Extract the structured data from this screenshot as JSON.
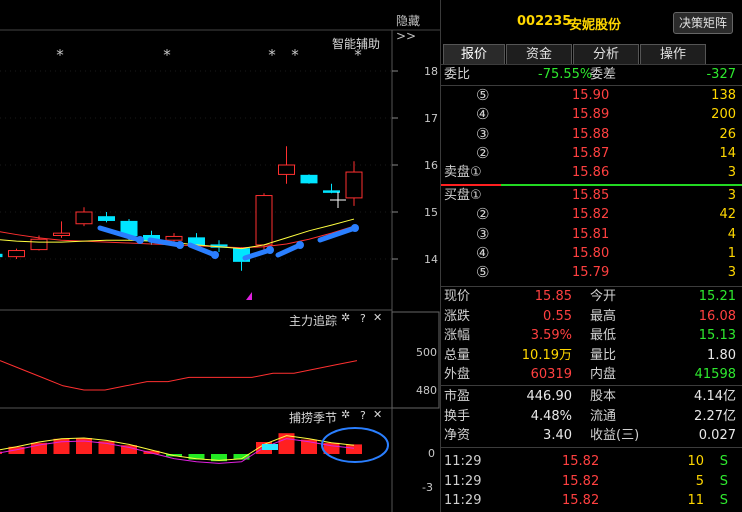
{
  "top_bar": {
    "hide_label": "隐藏>>",
    "smart_aid_label": "智能辅助"
  },
  "header": {
    "code": "002235",
    "name": "安妮股份",
    "decision_button": "决策矩阵"
  },
  "tabs": [
    "报价",
    "资金",
    "分析",
    "操作"
  ],
  "weibi": {
    "label": "委比",
    "ratio": "-75.55%",
    "diff_label": "委差",
    "diff": "-327"
  },
  "sell_levels": [
    {
      "label": "⑤",
      "price": "15.90",
      "volume": "138"
    },
    {
      "label": "④",
      "price": "15.89",
      "volume": "200"
    },
    {
      "label": "③",
      "price": "15.88",
      "volume": "26"
    },
    {
      "label": "②",
      "price": "15.87",
      "volume": "14"
    },
    {
      "label": "卖盘①",
      "price": "15.86",
      "volume": "3"
    }
  ],
  "buy_levels": [
    {
      "label": "买盘①",
      "price": "15.85",
      "volume": "3"
    },
    {
      "label": "②",
      "price": "15.82",
      "volume": "42"
    },
    {
      "label": "③",
      "price": "15.81",
      "volume": "4"
    },
    {
      "label": "④",
      "price": "15.80",
      "volume": "1"
    },
    {
      "label": "⑤",
      "price": "15.79",
      "volume": "3"
    }
  ],
  "stats": [
    {
      "l1": "现价",
      "v1": "15.85",
      "l2": "今开",
      "v2": "15.21"
    },
    {
      "l1": "涨跌",
      "v1": "0.55",
      "l2": "最高",
      "v2": "16.08"
    },
    {
      "l1": "涨幅",
      "v1": "3.59%",
      "l2": "最低",
      "v2": "15.13"
    },
    {
      "l1": "总量",
      "v1": "10.19万",
      "l2": "量比",
      "v2": "1.80"
    },
    {
      "l1": "外盘",
      "v1": "60319",
      "l2": "内盘",
      "v2": "41598"
    }
  ],
  "fundamentals": [
    {
      "l1": "市盈",
      "v1": "446.90",
      "l2": "股本",
      "v2": "4.14亿"
    },
    {
      "l1": "换手",
      "v1": "4.48%",
      "l2": "流通",
      "v2": "2.27亿"
    },
    {
      "l1": "净资",
      "v1": "3.40",
      "l2": "收益(三)",
      "v2": "0.027"
    }
  ],
  "ticks": [
    {
      "time": "11:29",
      "price": "15.82",
      "vol": "10",
      "side": "S"
    },
    {
      "time": "11:29",
      "price": "15.82",
      "vol": "5",
      "side": "S"
    },
    {
      "time": "11:29",
      "price": "15.82",
      "vol": "11",
      "side": "S"
    }
  ],
  "price_axis": [
    "18",
    "17",
    "16",
    "15",
    "14"
  ],
  "panel2": {
    "title": "主力追踪",
    "axis": [
      "500",
      "480"
    ]
  },
  "panel3": {
    "title": "捕捞季节",
    "axis": [
      "0",
      "-3"
    ]
  },
  "colors": {
    "up": "#ff3030",
    "down": "#00e5ff",
    "green": "#22e822",
    "accent": "#2a7fff"
  },
  "chart_data": [
    {
      "type": "candlestick",
      "title": "",
      "ylim": [
        13.5,
        18.4
      ],
      "y_ticks": [
        18,
        17,
        16,
        15,
        14
      ],
      "candles": [
        {
          "o": 14.1,
          "c": 14.05,
          "h": 14.12,
          "l": 14.0
        },
        {
          "o": 14.05,
          "c": 14.18,
          "h": 14.22,
          "l": 14.0
        },
        {
          "o": 14.2,
          "c": 14.42,
          "h": 14.5,
          "l": 14.18
        },
        {
          "o": 14.5,
          "c": 14.55,
          "h": 14.8,
          "l": 14.45
        },
        {
          "o": 14.75,
          "c": 15.0,
          "h": 15.1,
          "l": 14.7
        },
        {
          "o": 14.9,
          "c": 14.82,
          "h": 15.0,
          "l": 14.78
        },
        {
          "o": 14.8,
          "c": 14.5,
          "h": 14.85,
          "l": 14.4
        },
        {
          "o": 14.5,
          "c": 14.4,
          "h": 14.6,
          "l": 14.3
        },
        {
          "o": 14.4,
          "c": 14.48,
          "h": 14.55,
          "l": 14.35
        },
        {
          "o": 14.45,
          "c": 14.3,
          "h": 14.55,
          "l": 14.2
        },
        {
          "o": 14.3,
          "c": 14.25,
          "h": 14.4,
          "l": 14.15
        },
        {
          "o": 14.22,
          "c": 13.95,
          "h": 14.25,
          "l": 13.75
        },
        {
          "o": 14.3,
          "c": 15.35,
          "h": 15.4,
          "l": 14.2
        },
        {
          "o": 15.8,
          "c": 16.0,
          "h": 16.4,
          "l": 15.6
        },
        {
          "o": 15.78,
          "c": 15.62,
          "h": 15.8,
          "l": 15.6
        },
        {
          "o": 15.45,
          "c": 15.42,
          "h": 15.6,
          "l": 15.4
        },
        {
          "o": 15.3,
          "c": 15.85,
          "h": 16.08,
          "l": 15.13
        }
      ],
      "ma_yellow": [
        14.42,
        14.38,
        14.36,
        14.36,
        14.38,
        14.4,
        14.4,
        14.38,
        14.35,
        14.3,
        14.26,
        14.22,
        14.3,
        14.45,
        14.6,
        14.72,
        14.85
      ],
      "ma_red": [
        14.6,
        14.52,
        14.45,
        14.4,
        14.38,
        14.36,
        14.34,
        14.32,
        14.3,
        14.28,
        14.26,
        14.24,
        14.26,
        14.32,
        14.42,
        14.55,
        14.7
      ]
    },
    {
      "type": "line",
      "title": "主力追踪",
      "ylim": [
        470,
        520
      ],
      "y_ticks": [
        500,
        480
      ],
      "series": [
        {
          "values": [
            483,
            481,
            479,
            477,
            476,
            476,
            477,
            478,
            478,
            479,
            479,
            479,
            479,
            480,
            480,
            481,
            482,
            483
          ]
        }
      ]
    },
    {
      "type": "bar",
      "title": "捕捞季节",
      "ylim": [
        -4,
        4
      ],
      "y_ticks": [
        0,
        -3
      ],
      "values": [
        0.3,
        0.9,
        1.4,
        1.9,
        2.0,
        1.6,
        1.1,
        0.4,
        -0.3,
        -0.7,
        -0.9,
        -0.7,
        1.5,
        2.6,
        1.8,
        1.4,
        1.2
      ],
      "line": [
        0.4,
        0.9,
        1.5,
        1.9,
        2.0,
        1.7,
        1.2,
        0.5,
        -0.2,
        -0.6,
        -0.8,
        -0.6,
        1.2,
        2.3,
        1.9,
        1.4,
        1.1
      ]
    }
  ]
}
